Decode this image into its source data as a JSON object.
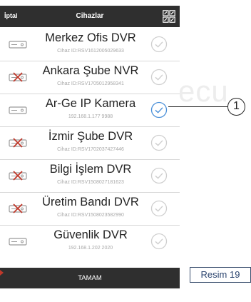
{
  "header": {
    "cancel_label": "İptal",
    "title": "Cihazlar"
  },
  "devices": [
    {
      "name": "Merkez Ofis DVR",
      "sub": "Cihaz ID:RSV1612005029633",
      "status": "online",
      "selected": false
    },
    {
      "name": "Ankara Şube NVR",
      "sub": "Cihaz ID:RSV1705012958341",
      "status": "offline",
      "selected": false
    },
    {
      "name": "Ar-Ge IP Kamera",
      "sub": "192.168.1.177   9988",
      "status": "online",
      "selected": true
    },
    {
      "name": "İzmir Şube DVR",
      "sub": "Cihaz ID:RSV1702037427446",
      "status": "offline",
      "selected": false
    },
    {
      "name": "Bilgi İşlem DVR",
      "sub": "Cihaz ID:RSV1508027181623",
      "status": "offline",
      "selected": false
    },
    {
      "name": "Üretim Bandı DVR",
      "sub": "Cihaz ID:RSV1508023582990",
      "status": "offline",
      "selected": false
    },
    {
      "name": "Güvenlik DVR",
      "sub": "192.168.1.202   2020",
      "status": "online",
      "selected": false
    }
  ],
  "footer": {
    "confirm_label": "TAMAM"
  },
  "annotations": {
    "callout_number": "1",
    "figure_label": "Resim 19",
    "background_text": "ecu"
  },
  "colors": {
    "header_bg": "#2f2f2f",
    "selected_check": "#4a90d9",
    "unselected_check": "#cfcfcf",
    "offline_icon": "#c0392b"
  }
}
